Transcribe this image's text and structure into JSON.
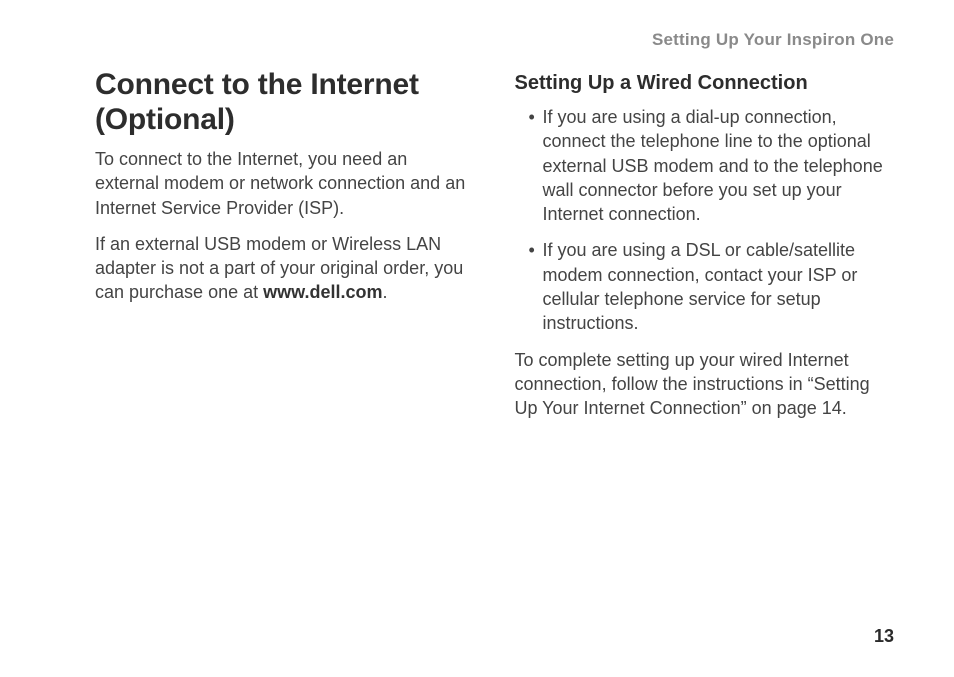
{
  "running_head": "Setting Up Your Inspiron One",
  "page_number": "13",
  "left_column": {
    "heading": "Connect to the Internet (Optional)",
    "p1": "To connect to the Internet, you need an external modem or network connection and an Internet Service Provider (ISP).",
    "p2_a": "If an external USB modem or Wireless LAN adapter is not a part of your original order, you can purchase one at ",
    "p2_url": "www.dell.com",
    "p2_b": "."
  },
  "right_column": {
    "subheading": "Setting Up a Wired Connection",
    "bullets": [
      "If you are using a dial-up connection, connect the telephone line to the optional external USB modem and to the telephone wall connector before you set up your Internet connection.",
      "If you are using a DSL or cable/satellite modem connection, contact your ISP or cellular telephone service for setup instructions."
    ],
    "closing": "To complete setting up your wired Internet connection, follow the instructions in “Setting Up Your Internet Connection” on page 14."
  }
}
